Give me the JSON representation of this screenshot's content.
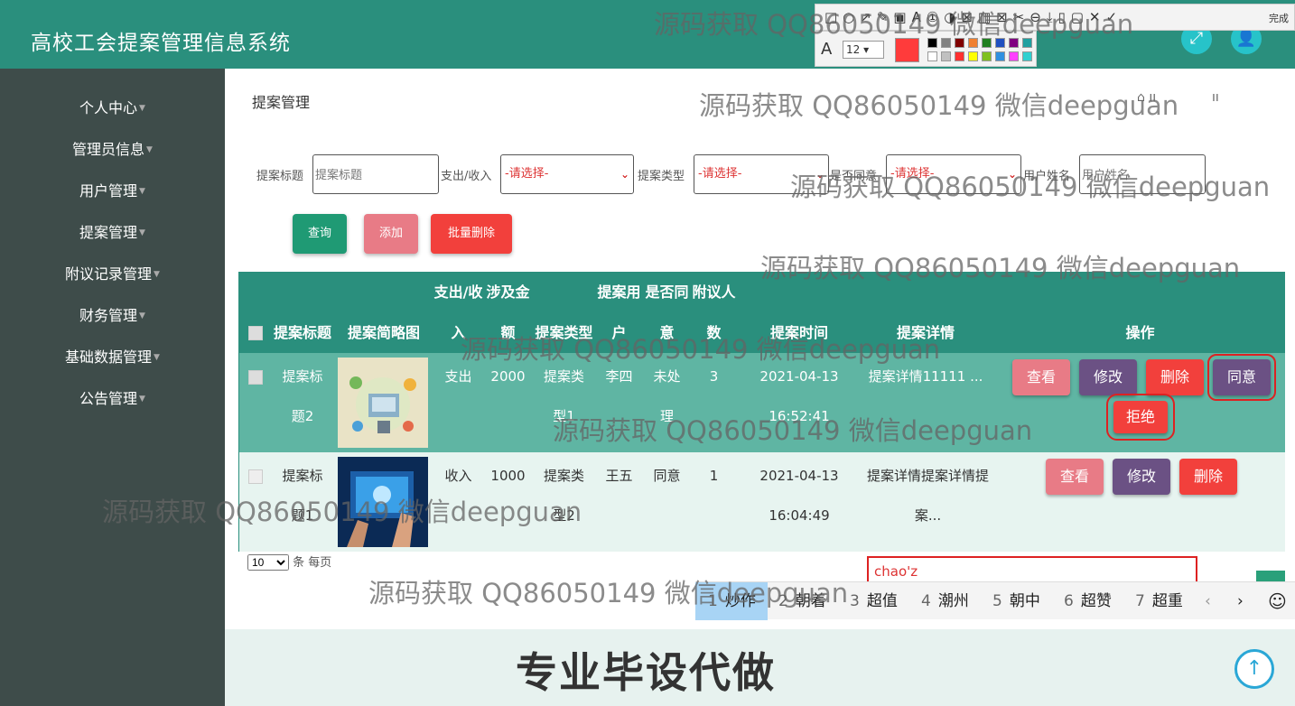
{
  "app": {
    "title": "高校工会提案管理信息系统"
  },
  "header": {
    "icon_left": "expand-icon",
    "icon_right": "user-icon",
    "icon_left_glyph": "⤢",
    "icon_right_glyph": "👤"
  },
  "sidebar": {
    "items": [
      {
        "label": "个人中心"
      },
      {
        "label": "管理员信息"
      },
      {
        "label": "用户管理"
      },
      {
        "label": "提案管理"
      },
      {
        "label": "附议记录管理"
      },
      {
        "label": "财务管理"
      },
      {
        "label": "基础数据管理"
      },
      {
        "label": "公告管理"
      }
    ],
    "caret": "▼"
  },
  "breadcrumb": {
    "current": "提案管理",
    "icons": "⌂ ıı",
    "icons2": "ıı"
  },
  "filters": {
    "title_label": "提案标题",
    "title_placeholder": "提案标题",
    "io_label": "支出/收入",
    "io_value": "-请选择-",
    "type_label": "提案类型",
    "type_value": "-请选择-",
    "agree_label": "是否同意",
    "agree_value": "-请选择-",
    "user_label": "用户姓名",
    "user_placeholder": "用户姓名"
  },
  "actions": {
    "search": "查询",
    "add": "添加",
    "batch_delete": "批量删除"
  },
  "table": {
    "headers": {
      "title": "提案标题",
      "image": "提案简略图",
      "io_1": "支出/收",
      "io_2": "入",
      "amount_1": "涉及金",
      "amount_2": "额",
      "type": "提案类型",
      "user_1": "提案用",
      "user_2": "户",
      "agree_1": "是否同",
      "agree_2": "意",
      "seconds_1": "附议人",
      "seconds_2": "数",
      "time": "提案时间",
      "detail": "提案详情",
      "ops": "操作"
    },
    "rows": [
      {
        "title_1": "提案标",
        "title_2": "题2",
        "io": "支出",
        "amount": "2000",
        "type_1": "提案类",
        "type_2": "型1",
        "user": "李四",
        "agree_1": "未处",
        "agree_2": "理",
        "seconds": "3",
        "date": "2021-04-13",
        "time": "16:52:41",
        "detail_1": "提案详情11111 ...",
        "detail_2": ""
      },
      {
        "title_1": "提案标",
        "title_2": "题1",
        "io": "收入",
        "amount": "1000",
        "type_1": "提案类",
        "type_2": "型2",
        "user": "王五",
        "agree_1": "同意",
        "agree_2": "",
        "seconds": "1",
        "date": "2021-04-13",
        "time": "16:04:49",
        "detail_1": "提案详情提案详情提",
        "detail_2": "案..."
      }
    ],
    "btn_view": "查看",
    "btn_edit": "修改",
    "btn_delete": "删除",
    "btn_agree": "同意",
    "btn_reject": "拒绝"
  },
  "pagination": {
    "page_size": "10",
    "suffix": "条 每页"
  },
  "ime": {
    "input": "chao'z",
    "candidates": [
      {
        "n": "1",
        "w": "炒作"
      },
      {
        "n": "2",
        "w": "朝着"
      },
      {
        "n": "3",
        "w": "超值"
      },
      {
        "n": "4",
        "w": "潮州"
      },
      {
        "n": "5",
        "w": "朝中"
      },
      {
        "n": "6",
        "w": "超赞"
      },
      {
        "n": "7",
        "w": "超重"
      }
    ],
    "prev": "‹",
    "next": "›",
    "emoji": "☺"
  },
  "screenshot_tool": {
    "font_icon": "A",
    "font_size": "12",
    "done": "完成",
    "icons": "□○↗✎▣A①◑⊠▥⊠✂⊖⤓▯▢✕✓",
    "colors": [
      "#000000",
      "#808080",
      "#800000",
      "#f08030",
      "#208020",
      "#2050c0",
      "#800080",
      "#20a0a0",
      "#ffffff",
      "#c0c0c0",
      "#ff3030",
      "#ffff00",
      "#80c020",
      "#3090e0",
      "#ff40ff",
      "#30d0d0"
    ],
    "active_color": "#ff3b3b"
  },
  "footer": {
    "text": "专业毕设代做",
    "top_icon": "↑"
  },
  "watermark": "源码获取 QQ86050149 微信deepguan"
}
